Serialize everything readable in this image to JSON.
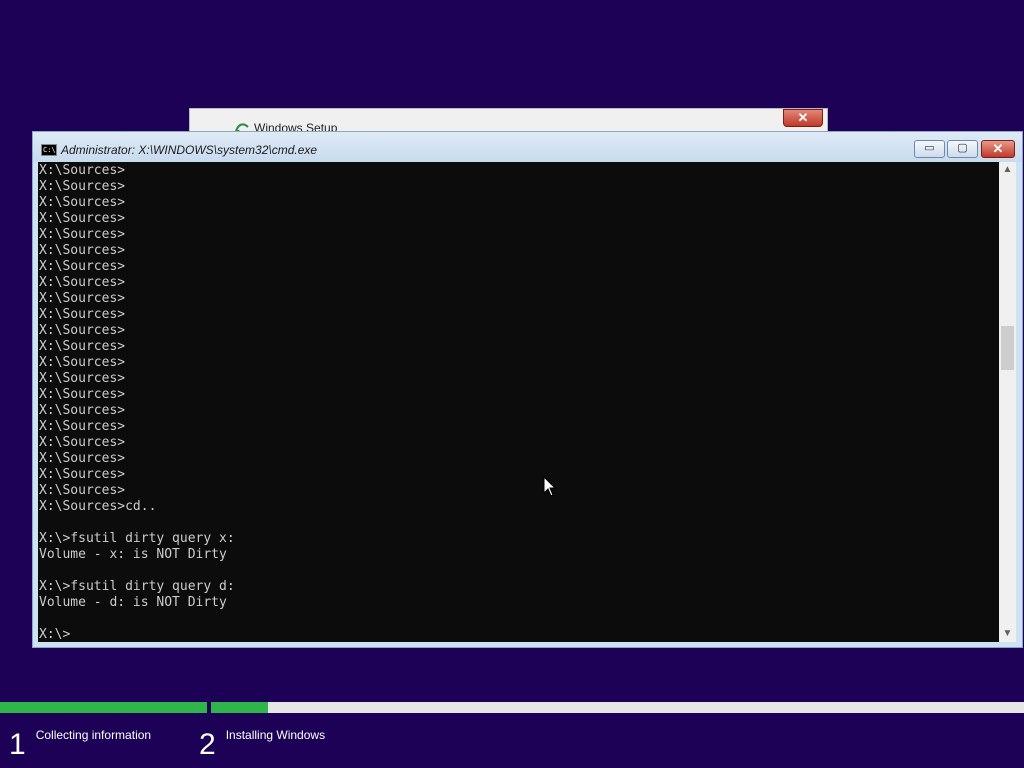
{
  "setup_window": {
    "title": "Windows Setup",
    "close_glyph": "✕"
  },
  "cmd_window": {
    "title": "Administrator: X:\\WINDOWS\\system32\\cmd.exe",
    "minimize_glyph": "▭",
    "maximize_glyph": "▢",
    "close_glyph": "✕",
    "console_lines": [
      "X:\\Sources>",
      "X:\\Sources>",
      "X:\\Sources>",
      "X:\\Sources>",
      "X:\\Sources>",
      "X:\\Sources>",
      "X:\\Sources>",
      "X:\\Sources>",
      "X:\\Sources>",
      "X:\\Sources>",
      "X:\\Sources>",
      "X:\\Sources>",
      "X:\\Sources>",
      "X:\\Sources>",
      "X:\\Sources>",
      "X:\\Sources>",
      "X:\\Sources>",
      "X:\\Sources>",
      "X:\\Sources>",
      "X:\\Sources>",
      "X:\\Sources>",
      "X:\\Sources>cd..",
      "",
      "X:\\>fsutil dirty query x:",
      "Volume - x: is NOT Dirty",
      "",
      "X:\\>fsutil dirty query d:",
      "Volume - d: is NOT Dirty",
      "",
      "X:\\>"
    ],
    "scroll_up_glyph": "▲",
    "scroll_down_glyph": "▼"
  },
  "progress": {
    "steps": [
      {
        "number": "1",
        "label": "Collecting information"
      },
      {
        "number": "2",
        "label": "Installing Windows"
      }
    ],
    "step1_fraction": 1.0,
    "step2_fraction": 0.07
  },
  "colors": {
    "background": "#1c0157",
    "progress_fill": "#2fb54a",
    "progress_track": "#e6e6e6",
    "console_bg": "#0c0c0c",
    "console_text": "#cccccc"
  },
  "icons": {
    "cmd_icon": "command-prompt-icon",
    "setup_icon": "windows-setup-icon",
    "cursor": "mouse-pointer-icon"
  }
}
